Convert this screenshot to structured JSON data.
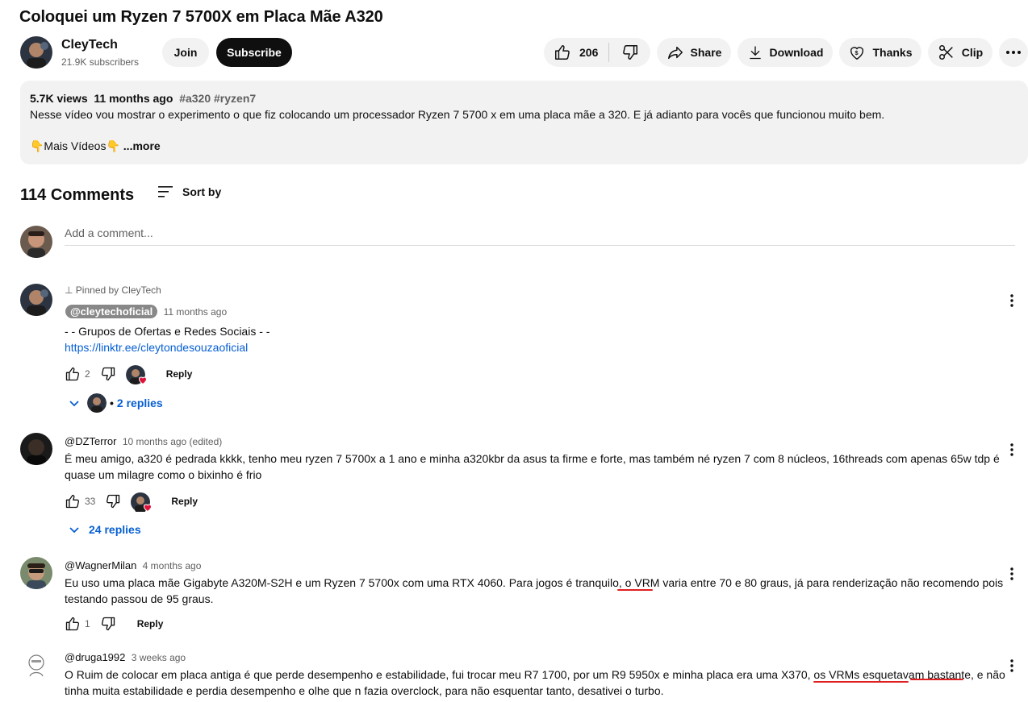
{
  "video": {
    "title": "Coloquei um Ryzen 7 5700X em Placa Mãe A320",
    "channel": "CleyTech",
    "subscribers": "21.9K subscribers",
    "join_label": "Join",
    "subscribe_label": "Subscribe",
    "likes": "206",
    "share_label": "Share",
    "download_label": "Download",
    "thanks_label": "Thanks",
    "clip_label": "Clip"
  },
  "description": {
    "views": "5.7K views",
    "age": "11 months ago",
    "tags": "#a320 #ryzen7",
    "text": "Nesse vídeo vou mostrar o experimento o que fiz colocando um processador Ryzen 7 5700 x em uma placa mãe a 320. E já adianto para vocês que funcionou muito bem.",
    "more_line": "👇Mais Vídeos👇",
    "more_label": "...more"
  },
  "comments_header": {
    "count": "114 Comments",
    "sort_label": "Sort by",
    "add_placeholder": "Add a comment..."
  },
  "comments": [
    {
      "pinned": "Pinned by CleyTech",
      "author": "@cleytechoficial",
      "time": "11 months ago",
      "line1": "- - Grupos de Ofertas e Redes Sociais - -",
      "link": "https://linktr.ee/cleytondesouzaoficial",
      "likes": "2",
      "reply_label": "Reply",
      "replies": "2 replies"
    },
    {
      "author": "@DZTerror",
      "time": "10 months ago (edited)",
      "line1": "É meu amigo, a320 é pedrada kkkk, tenho meu ryzen 7 5700x a 1 ano e minha a320kbr da asus ta firme e forte, mas também né ryzen 7 com 8 núcleos, 16threads com apenas 65w tdp é",
      "line2": "quase um milagre como o bixinho é frio",
      "likes": "33",
      "reply_label": "Reply",
      "replies": "24 replies"
    },
    {
      "author": "@WagnerMilan",
      "time": "4 months ago",
      "line1": "Eu uso uma placa mãe Gigabyte A320M-S2H e um Ryzen 7 5700x com uma RTX 4060. Para jogos é tranquilo, o VRM varia entre 70 e 80 graus, já para renderização não recomendo pois",
      "line2": "testando passou de 95 graus.",
      "likes": "1",
      "reply_label": "Reply"
    },
    {
      "author": "@druga1992",
      "time": "3 weeks ago",
      "line1": "O Ruim de colocar em placa antiga é que perde desempenho e estabilidade, fui trocar meu R7 1700, por um R9 5950x e minha placa era uma X370, os VRMs esquetavam bastante, e não",
      "line2": "tinha muita estabilidade e perdia desempenho e olhe que n fazia overclock, para não esquentar tanto, desativei o turbo."
    }
  ],
  "colors": {
    "link": "#065fd4",
    "annotation_red": "#e02020",
    "pill_bg": "#f2f2f2",
    "subscribe_bg": "#0f0f0f"
  }
}
